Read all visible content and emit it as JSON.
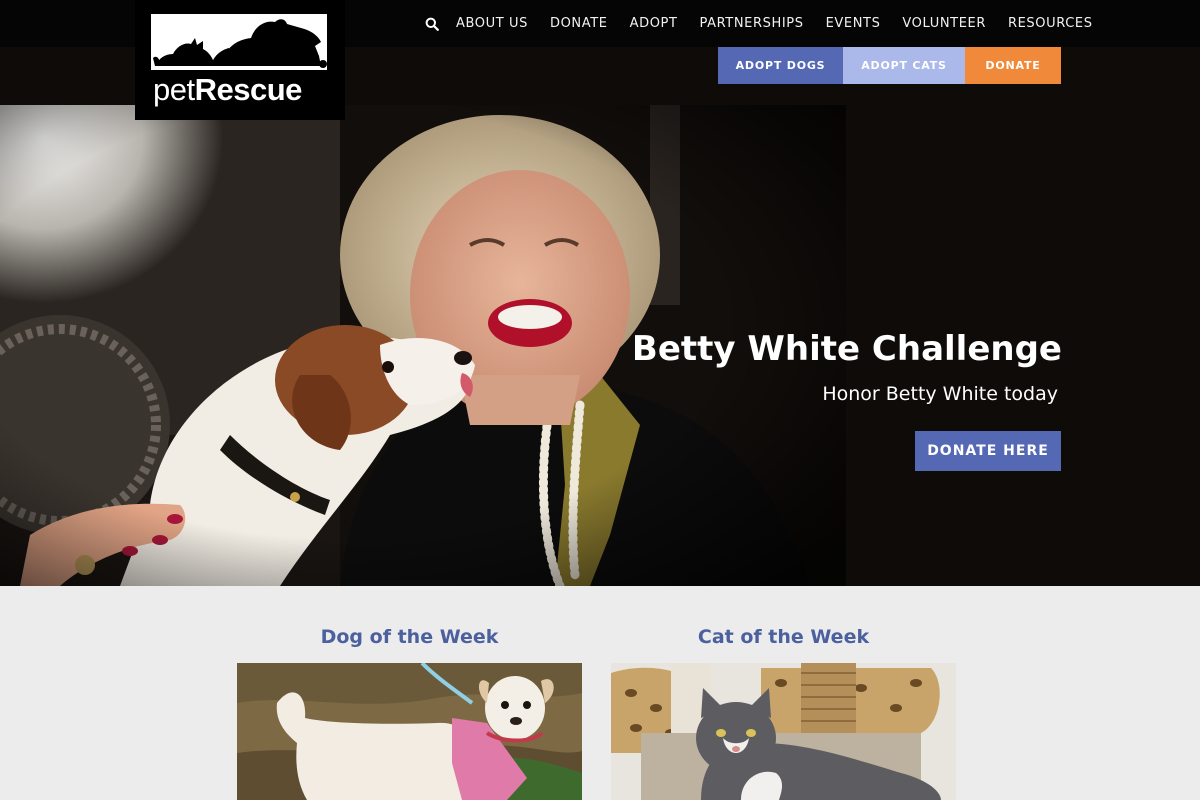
{
  "logo": {
    "text_light": "pet",
    "text_bold": "Rescue",
    "reg_mark": "®"
  },
  "nav": {
    "search_icon": "search-icon",
    "items": [
      "ABOUT US",
      "DONATE",
      "ADOPT",
      "PARTNERSHIPS",
      "EVENTS",
      "VOLUNTEER",
      "RESOURCES"
    ]
  },
  "subnav": {
    "adopt_dogs": "ADOPT DOGS",
    "adopt_cats": "ADOPT CATS",
    "donate": "DONATE"
  },
  "hero": {
    "title": "Betty White Challenge",
    "subtitle": "Honor Betty White today",
    "button": "DONATE HERE"
  },
  "features": {
    "dog_title": "Dog of the Week",
    "cat_title": "Cat of the Week"
  },
  "colors": {
    "nav_bg": "#050505",
    "primary_blue": "#5468b4",
    "light_blue": "#aab8ea",
    "orange": "#f08a3a",
    "heading_blue": "#4c5f9e",
    "section_bg": "#ececec"
  }
}
